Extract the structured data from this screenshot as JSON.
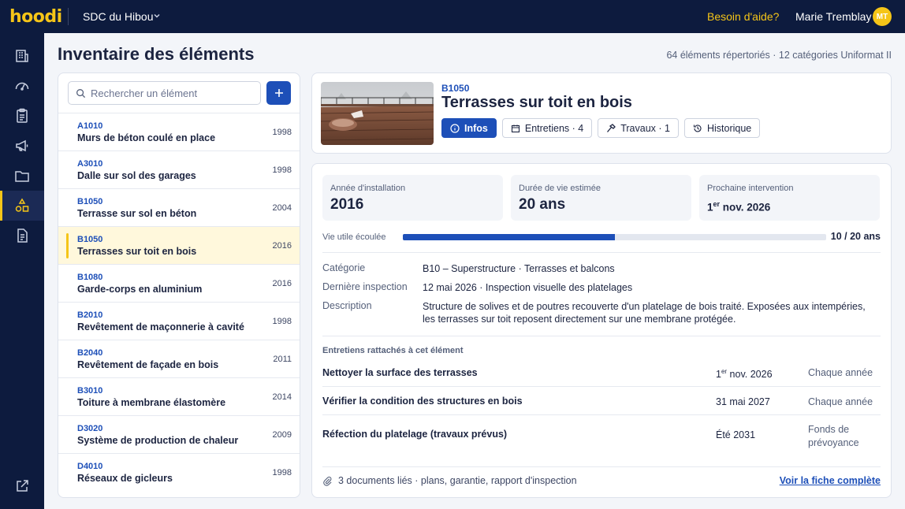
{
  "app": {
    "logo": "hoodi",
    "organization": "SDC du Hibou",
    "help": "Besoin d'aide?",
    "user_name": "Marie Tremblay",
    "user_initials": "MT"
  },
  "sidebar": {
    "items": [
      {
        "icon": "building-icon",
        "active": false
      },
      {
        "icon": "gauge-icon",
        "active": false
      },
      {
        "icon": "clipboard-icon",
        "active": false
      },
      {
        "icon": "megaphone-icon",
        "active": false
      },
      {
        "icon": "folder-icon",
        "active": false
      },
      {
        "icon": "components-icon",
        "active": true
      },
      {
        "icon": "document-icon",
        "active": false
      }
    ],
    "bottom_icon": "external-link-icon"
  },
  "page": {
    "title": "Inventaire des éléments",
    "meta": "64 éléments répertoriés · 12 catégories Uniformat II"
  },
  "search": {
    "placeholder": "Rechercher un élément",
    "value": ""
  },
  "items": [
    {
      "code": "A1010",
      "name": "Murs de béton coulé en place",
      "year": "1998",
      "selected": false
    },
    {
      "code": "A3010",
      "name": "Dalle sur sol des garages",
      "year": "1998",
      "selected": false
    },
    {
      "code": "B1050",
      "name": "Terrasse sur sol en béton",
      "year": "2004",
      "selected": false
    },
    {
      "code": "B1050",
      "name": "Terrasses sur toit en bois",
      "year": "2016",
      "selected": true
    },
    {
      "code": "B1080",
      "name": "Garde-corps en aluminium",
      "year": "2016",
      "selected": false
    },
    {
      "code": "B2010",
      "name": "Revêtement de maçonnerie à cavité",
      "year": "1998",
      "selected": false
    },
    {
      "code": "B2040",
      "name": "Revêtement de façade en bois",
      "year": "2011",
      "selected": false
    },
    {
      "code": "B3010",
      "name": "Toiture à membrane élastomère",
      "year": "2014",
      "selected": false
    },
    {
      "code": "D3020",
      "name": "Système de production de chaleur",
      "year": "2009",
      "selected": false
    },
    {
      "code": "D4010",
      "name": "Réseaux de gicleurs",
      "year": "1998",
      "selected": false
    }
  ],
  "detail": {
    "code": "B1050",
    "title": "Terrasses sur toit en bois",
    "tabs": [
      {
        "label": "Infos",
        "icon": "info-icon",
        "active": true
      },
      {
        "label": "Entretiens · 4",
        "icon": "calendar-icon",
        "active": false
      },
      {
        "label": "Travaux · 1",
        "icon": "hammer-icon",
        "active": false
      },
      {
        "label": "Historique",
        "icon": "history-icon",
        "active": false
      }
    ],
    "stats": {
      "install_label": "Année d'installation",
      "install_value": "2016",
      "life_label": "Durée de vie estimée",
      "life_value": "20 ans",
      "next_label": "Prochaine intervention",
      "next_day": "1",
      "next_sup": "er",
      "next_rest": " nov. 2026"
    },
    "life_elapsed": {
      "label": "Vie utile écoulée",
      "value_text": "10 / 20 ans",
      "fraction": 0.5
    },
    "info": {
      "category_label": "Catégorie",
      "category_value": "B10 – Superstructure · Terrasses et balcons",
      "inspection_label": "Dernière inspection",
      "inspection_value": "12 mai 2026 · Inspection visuelle des platelages",
      "description_label": "Description",
      "description_value": "Structure de solives et de poutres recouverte d'un platelage de bois traité. Exposées aux intempéries, les terrasses sur toit reposent directement sur une membrane protégée."
    },
    "maintenance": {
      "title": "Entretiens rattachés à cet élément",
      "rows": [
        {
          "name": "Nettoyer la surface des terrasses",
          "date_day": "1",
          "date_sup": "er",
          "date_rest": " nov. 2026",
          "frequency": "Chaque année"
        },
        {
          "name": "Vérifier la condition des structures en bois",
          "date_day": "",
          "date_sup": "",
          "date_rest": "31 mai 2027",
          "frequency": "Chaque année"
        },
        {
          "name": "Réfection du platelage (travaux prévus)",
          "date_day": "",
          "date_sup": "",
          "date_rest": "Été 2031",
          "frequency": "Fonds de prévoyance"
        }
      ]
    },
    "docs_text": "3 documents liés · plans, garantie, rapport d'inspection",
    "full_link": "Voir la fiche complète"
  },
  "colors": {
    "navy": "#0d1b3e",
    "accent_yellow": "#f5c518",
    "primary_blue": "#1d4fb8"
  }
}
